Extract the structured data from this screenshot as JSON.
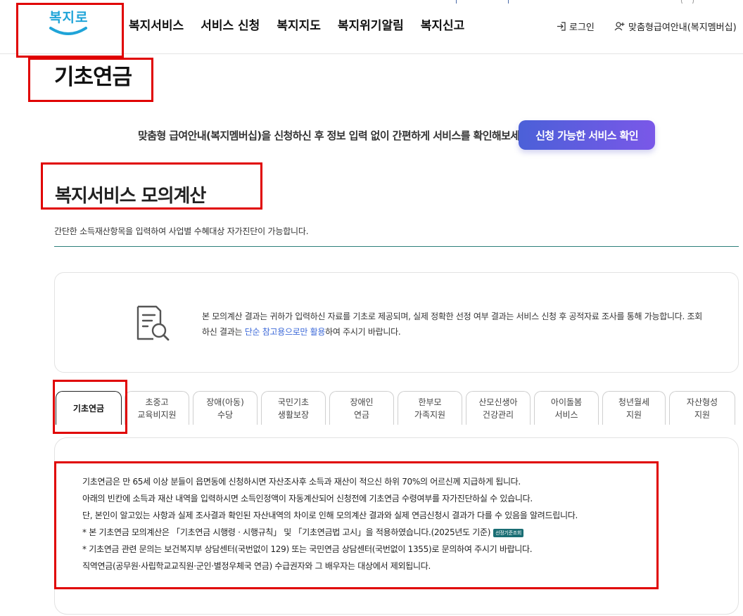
{
  "header": {
    "logo_text": "복지로",
    "nav": [
      "복지서비스",
      "서비스 신청",
      "복지지도",
      "복지위기알림",
      "복지신고"
    ],
    "login_label": "로그인",
    "member_label": "맞춤형급여안내(복지멤버십)"
  },
  "page": {
    "title": "기초연금"
  },
  "banner": {
    "text": "맞춤형 급여안내(복지멤버십)을 신청하신 후 정보 입력 없이 간편하게 서비스를 확인해보세요!",
    "button_label": "신청 가능한 서비스 확인"
  },
  "section": {
    "title": "복지서비스 모의계산",
    "description": "간단한 소득재산항목을 입력하여 사업별 수혜대상 자가진단이 가능합니다."
  },
  "notice": {
    "text_before": "본 모의계산 결과는 귀하가 입력하신 자료를 기초로 제공되며, 실제 정확한 선정 여부 결과는 서비스 신청 후 공적자료 조사를 통해 가능합니다. 조회하신 결과는 ",
    "link_text": "단순 참고용으로만 활용",
    "text_after": "하여 주시기 바랍니다."
  },
  "tabs": [
    {
      "line1": "기초연금",
      "line2": ""
    },
    {
      "line1": "초중고",
      "line2": "교육비지원"
    },
    {
      "line1": "장애(아동)",
      "line2": "수당"
    },
    {
      "line1": "국민기초",
      "line2": "생활보장"
    },
    {
      "line1": "장애인",
      "line2": "연금"
    },
    {
      "line1": "한부모",
      "line2": "가족지원"
    },
    {
      "line1": "산모신생아",
      "line2": "건강관리"
    },
    {
      "line1": "아이돌봄",
      "line2": "서비스"
    },
    {
      "line1": "청년월세",
      "line2": "지원"
    },
    {
      "line1": "자산형성",
      "line2": "지원"
    }
  ],
  "active_tab": 0,
  "content": {
    "lines": [
      "기초연금은 만 65세 이상 분들이 읍면동에 신청하시면 자산조사후 소득과 재산이 적으신 하위 70%의 어르신께 지급하게 됩니다.",
      "아래의 빈칸에 소득과 재산 내역을 입력하시면 소득인정액이 자동계산되어 신청전에 기초연금 수령여부를 자가진단하실 수 있습니다.",
      "단, 본인이 알고있는 사항과 실제 조사결과 확인된 자산내역의 차이로 인해 모의계산 결과와 실제 연금신청시 결과가 다를 수 있음을 알려드립니다.",
      "* 본 기초연금 모의계산은 「기초연금 시행령 · 시행규칙」 및 「기초연금법 고시」을 적용하였습니다.(2025년도 기준)",
      "* 기초연금 관련 문의는 보건복지부 상담센터(국번없이 129) 또는 국민연금 상담센터(국번없이 1355)로 문의하여 주시기 바랍니다.",
      "직역연금(공무원·사립학교교직원·군인·별정우체국 연금) 수급권자와 그 배우자는 대상에서 제외됩니다."
    ],
    "badge": "선정기준조회"
  },
  "colors": {
    "highlight": "#e00000",
    "button_gradient_start": "#4b60d8",
    "button_gradient_end": "#7a58e8",
    "section_rule": "#2d7f7c",
    "link": "#3b68d8",
    "logo": "#1fa4d8"
  },
  "icons": [
    "logo-smile-icon",
    "login-icon",
    "member-icon",
    "document-search-icon"
  ]
}
